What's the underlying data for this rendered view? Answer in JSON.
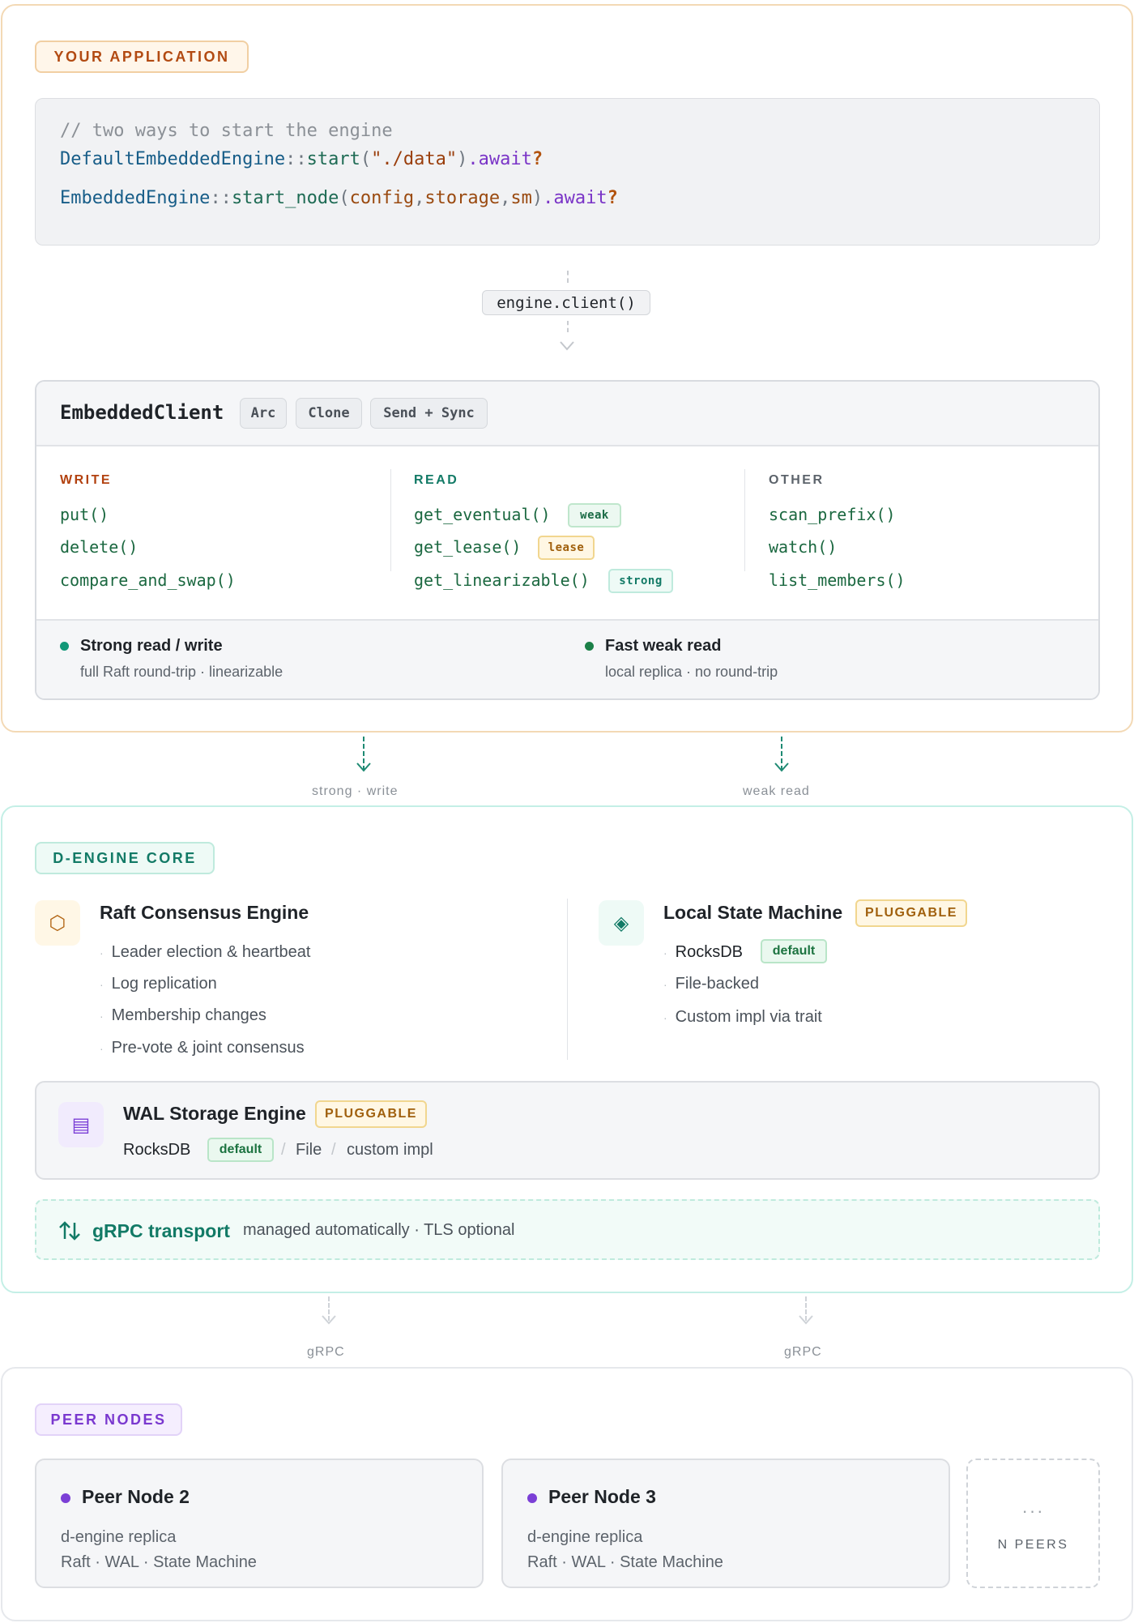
{
  "app": {
    "tag": "YOUR APPLICATION",
    "code": {
      "comment": "// two ways to start the engine",
      "line1": {
        "type": "DefaultEmbeddedEngine",
        "sep": "::",
        "fn": "start",
        "open": "(",
        "arg": "\"./data\"",
        "close": ")",
        "await": ".await",
        "q": "?"
      },
      "line2": {
        "type": "EmbeddedEngine",
        "sep": "::",
        "fn": "start_node",
        "open": "(",
        "a1": "config",
        "comma1": ",",
        "a2": "storage",
        "comma2": ",",
        "a3": "sm",
        "close": ")",
        "await": ".await",
        "q": "?"
      }
    },
    "client_call": "engine.client()"
  },
  "client": {
    "title": "EmbeddedClient",
    "traits": [
      "Arc",
      "Clone",
      "Send + Sync"
    ],
    "write": {
      "heading": "WRITE",
      "methods": [
        "put()",
        "delete()",
        "compare_and_swap()"
      ]
    },
    "read": {
      "heading": "READ",
      "methods": [
        {
          "name": "get_eventual()",
          "badge": "weak"
        },
        {
          "name": "get_lease()",
          "badge": "lease"
        },
        {
          "name": "get_linearizable()",
          "badge": "strong"
        }
      ]
    },
    "other": {
      "heading": "OTHER",
      "methods": [
        "scan_prefix()",
        "watch()",
        "list_members()"
      ]
    },
    "footer": {
      "strong": {
        "title": "Strong read / write",
        "sub": "full Raft round-trip · linearizable"
      },
      "weak": {
        "title": "Fast weak read",
        "sub": "local replica · no round-trip"
      }
    }
  },
  "flows": {
    "strong": "strong · write",
    "weak": "weak read",
    "grpc_left": "gRPC",
    "grpc_right": "gRPC"
  },
  "core": {
    "tag": "D-ENGINE CORE",
    "raft": {
      "icon": "hexagon-icon",
      "title": "Raft Consensus Engine",
      "items": [
        "Leader election & heartbeat",
        "Log replication",
        "Membership changes",
        "Pre-vote & joint consensus"
      ]
    },
    "state_machine": {
      "icon": "diamond-icon",
      "title": "Local State Machine",
      "badge": "PLUGGABLE",
      "items": [
        {
          "label": "RocksDB",
          "badge": "default"
        },
        {
          "label": "File-backed"
        },
        {
          "label": "Custom impl via trait"
        }
      ]
    },
    "wal": {
      "icon": "storage-icon",
      "title": "WAL Storage Engine",
      "badge": "PLUGGABLE",
      "primary": "RocksDB",
      "primary_badge": "default",
      "slash": "/",
      "opt1": "File",
      "opt2": "custom impl"
    },
    "grpc": {
      "icon": "transfer-arrows-icon",
      "title": "gRPC transport",
      "sub": "managed automatically · TLS optional"
    }
  },
  "peers": {
    "tag": "PEER NODES",
    "nodes": [
      {
        "title": "Peer Node 2",
        "sub1": "d-engine replica",
        "sub2": "Raft · WAL · State Machine"
      },
      {
        "title": "Peer Node 3",
        "sub1": "d-engine replica",
        "sub2": "Raft · WAL · State Machine"
      }
    ],
    "more": {
      "glyph": "···",
      "label": "N PEERS"
    }
  },
  "colors": {
    "app_accent": "#b24a12",
    "core_accent": "#127a66",
    "peer_accent": "#7b3fd6",
    "method_green": "#1b6840"
  }
}
